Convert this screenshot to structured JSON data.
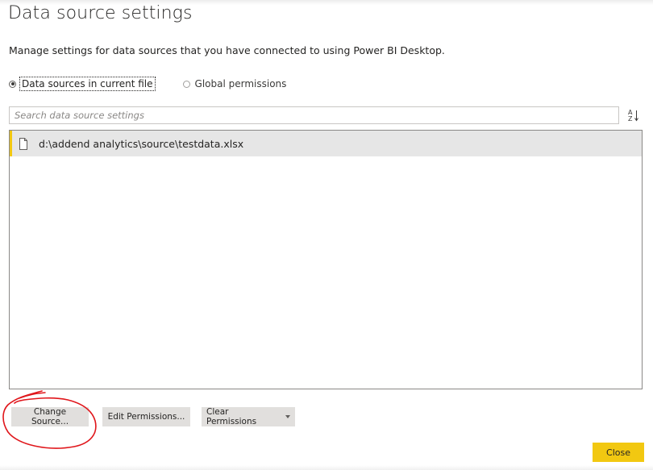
{
  "dialog": {
    "title": "Data source settings",
    "subtitle": "Manage settings for data sources that you have connected to using Power BI Desktop."
  },
  "scope": {
    "options": [
      {
        "label": "Data sources in current file",
        "selected": true
      },
      {
        "label": "Global permissions",
        "selected": false
      }
    ]
  },
  "search": {
    "placeholder": "Search data source settings",
    "value": ""
  },
  "sort": {
    "icon": "sort-az-icon"
  },
  "sources": [
    {
      "label": "d:\\addend analytics\\source\\testdata.xlsx",
      "icon": "file-icon",
      "selected": true
    }
  ],
  "actions": {
    "change_source": "Change Source...",
    "edit_permissions": "Edit Permissions...",
    "clear_permissions": "Clear Permissions",
    "close": "Close"
  },
  "colors": {
    "accent": "#f2c811",
    "annotation": "#e0161b",
    "selection": "#e6e6e6",
    "button": "#e1dfdd"
  }
}
